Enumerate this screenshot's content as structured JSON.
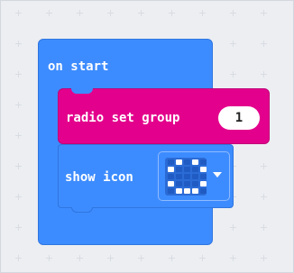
{
  "workspace": {
    "on_start_block": {
      "label": "on start",
      "color": "#3d8cff"
    },
    "radio_block": {
      "label": "radio set group",
      "value": "1",
      "color": "#e3008c"
    },
    "show_icon_block": {
      "label": "show icon",
      "color": "#3d8cff",
      "icon": "led-matrix-icon",
      "dropdown_icon": "chevron-down-icon"
    }
  }
}
